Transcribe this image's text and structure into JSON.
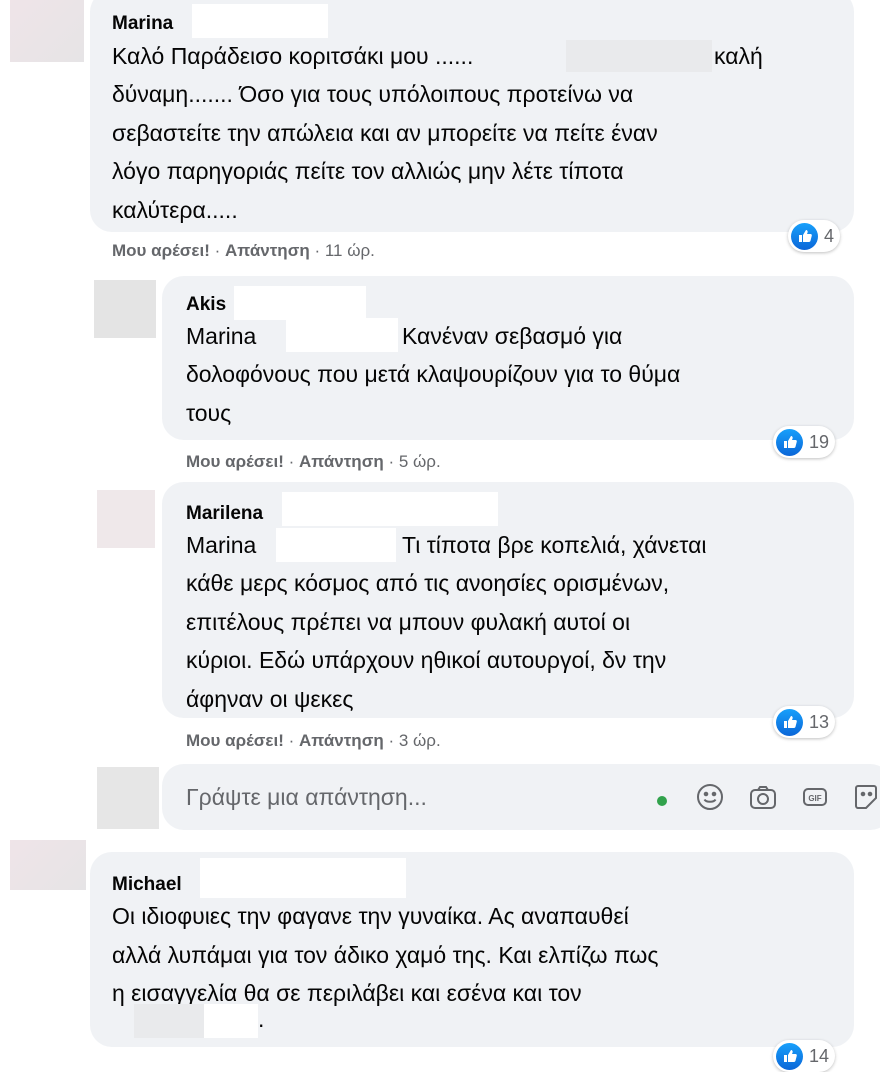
{
  "comments": [
    {
      "author": "Marina",
      "text": "Καλό Παράδεισο κοριτσάκι μου ......",
      "text_after": "καλή",
      "text_rest": "δύναμη....... Όσο για τους υπόλοιπους προτείνω να\nσεβαστείτε την απώλεια και αν μπορείτε να πείτε έναν\nλόγο παρηγοριάς πείτε τον αλλιώς μην λέτε τίποτα\nκαλύτερα.....",
      "like_label": "Μου αρέσει!",
      "reply_label": "Απάντηση",
      "time": "11 ώρ.",
      "reactions": "4"
    },
    {
      "author": "Akis",
      "mention": "Marina",
      "text_line1": "Κανέναν σεβασμό για",
      "text_rest": "δολοφόνους που μετά κλαψουρίζουν για το θύμα\nτους",
      "like_label": "Μου αρέσει!",
      "reply_label": "Απάντηση",
      "time": "5 ώρ.",
      "reactions": "19"
    },
    {
      "author": "Marilena",
      "mention": "Marina",
      "text_line1": "Τι τίποτα βρε κοπελιά, χάνεται",
      "text_rest": "κάθε μερς κόσμος από τις ανοησίες ορισμένων,\nεπιτέλους πρέπει να μπουν φυλακή αυτοί οι\nκύριοι. Εδώ υπάρχουν ηθικοί αυτουργοί, δν την\nάφηναν οι ψεκες",
      "like_label": "Μου αρέσει!",
      "reply_label": "Απάντηση",
      "time": "3 ώρ.",
      "reactions": "13"
    },
    {
      "author": "Michael",
      "text": "Οι ιδιοφυιες την φαγανε την γυναίκα. Ας αναπαυθεί\nαλλά λυπάμαι για τον άδικο χαμό της. Και ελπίζω πως\nη εισαγγελία θα σε περιλάβει και εσένα και τον",
      "text_tail": ".",
      "reactions": "14"
    }
  ],
  "reply_box": {
    "placeholder": "Γράψτε μια απάντηση..."
  },
  "icons": [
    "like-icon",
    "emoji-icon",
    "camera-icon",
    "gif-icon",
    "sticker-icon"
  ],
  "colors": {
    "like_blue": "#1877f2",
    "bubble": "#f0f2f5",
    "meta_gray": "#65676b",
    "online_green": "#31a24c"
  }
}
